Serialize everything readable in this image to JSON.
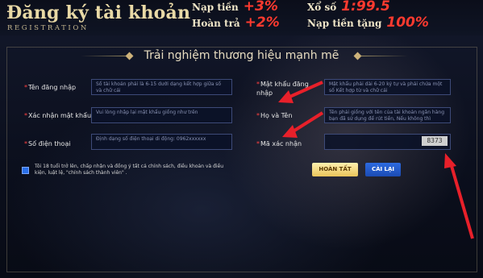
{
  "header": {
    "title": "Đăng ký tài khoản",
    "subtitle": "REGISTRATION",
    "promos": [
      {
        "label": "Nạp tiền",
        "value": "+3%"
      },
      {
        "label": "Xổ số",
        "value": "1:99.5"
      },
      {
        "label": "Hoàn trả",
        "value": "+2%"
      },
      {
        "label": "Nạp tiền tặng",
        "value": "100%"
      }
    ]
  },
  "panel_title": "Trải nghiệm thương hiệu mạnh mẽ",
  "form": {
    "username": {
      "label": "Tên đăng nhập",
      "placeholder": "Số tài khoản phải là 6-15 dưới dạng kết hợp giữa số và chữ cái"
    },
    "confirm_password": {
      "label": "Xác nhận mật khẩu",
      "placeholder": "Vui lòng nhập lại mật khẩu giống như trên"
    },
    "phone": {
      "label": "Số điện thoại",
      "placeholder": "Định dạng số điện thoại di động: 0962xxxxxx"
    },
    "password": {
      "label": "Mật khẩu đăng nhập",
      "placeholder": "Mật khẩu phải dài 6-20 ký tự và phải chứa một số Kết hợp từ và chữ cái"
    },
    "fullname": {
      "label": "Họ và Tên",
      "placeholder": "Tên phải giống với tên của tài khoản ngân hàng bạn đã sử dụng để rút tiền, Nếu không thì không"
    },
    "captcha": {
      "label": "Mã xác nhận",
      "code": "8373"
    },
    "terms": "Tôi 18 tuổi trở lên, chấp nhận và đồng ý tất cả chính sách, điều khoản và điều kiện, luật lệ, \"chính sách thành viên\" .",
    "submit_label": "HOÀN TẤT",
    "reset_label": "CÀI LẠI"
  },
  "colors": {
    "accent_red": "#ff3a2f",
    "gold": "#e9d9a6",
    "submit_bg": "#e9c45a",
    "reset_bg": "#2d6be0",
    "arrow": "#e8202a"
  }
}
